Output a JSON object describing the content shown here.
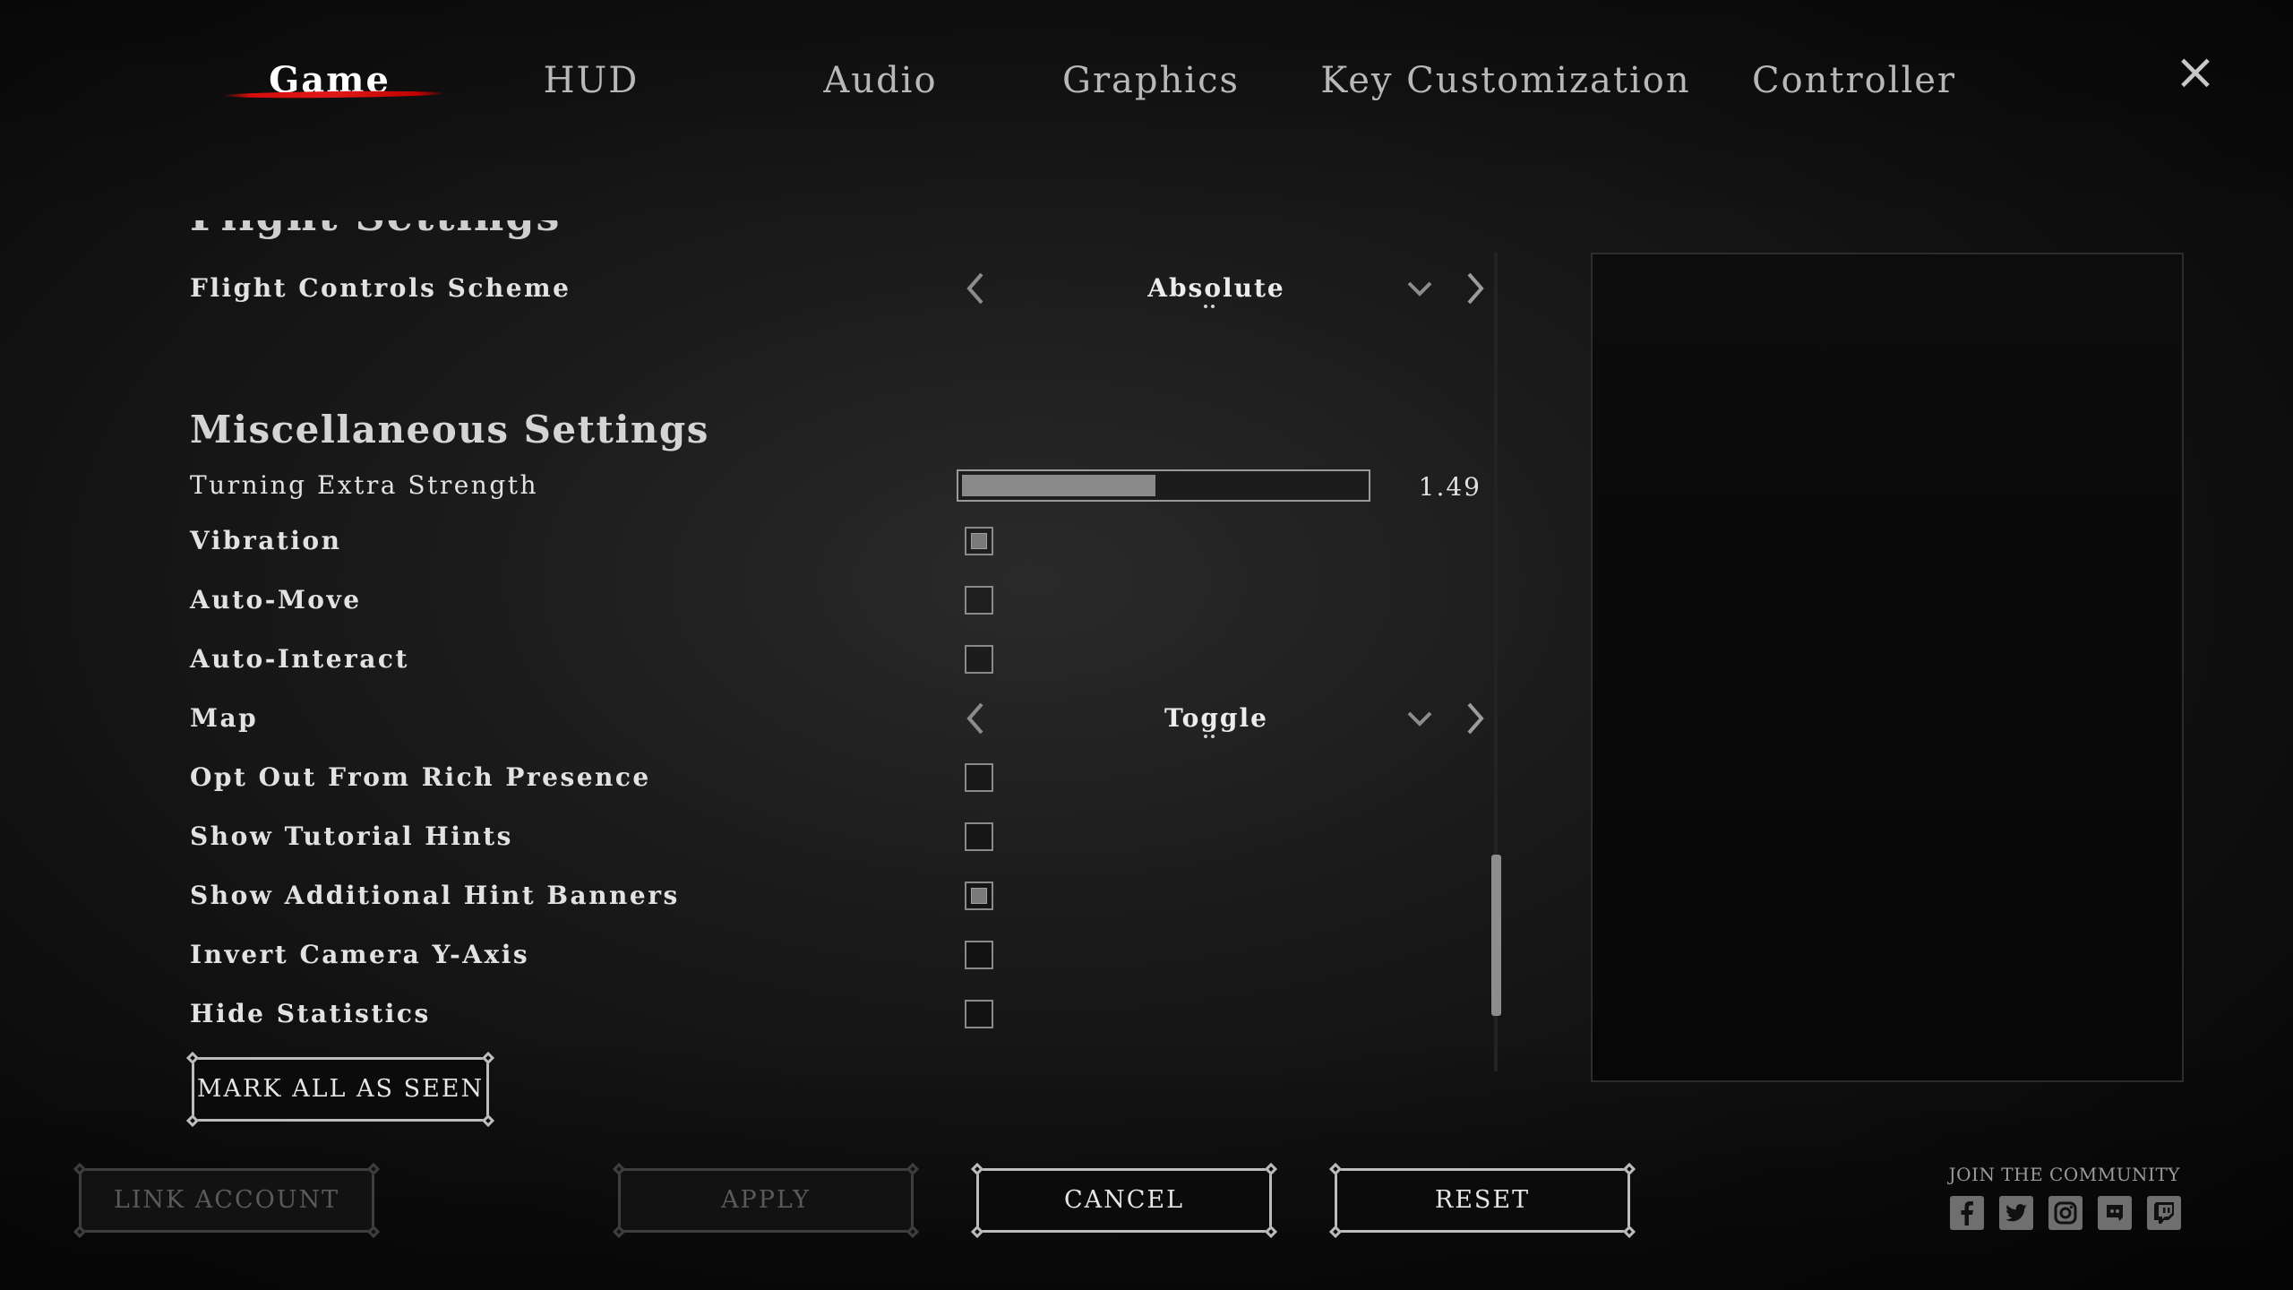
{
  "tabs": [
    {
      "label": "Game",
      "active": true
    },
    {
      "label": "HUD",
      "active": false
    },
    {
      "label": "Audio",
      "active": false
    },
    {
      "label": "Graphics",
      "active": false
    },
    {
      "label": "Key Customization",
      "active": false
    },
    {
      "label": "Controller",
      "active": false
    }
  ],
  "close_icon": "×",
  "flight": {
    "section_heading_partial": "Flight Settings",
    "controls_scheme": {
      "label": "Flight Controls Scheme",
      "value": "Absolute"
    }
  },
  "misc": {
    "heading": "Miscellaneous Settings",
    "turning_strength": {
      "label": "Turning Extra Strength",
      "value": "1.49",
      "fill_fraction": 0.48
    },
    "vibration": {
      "label": "Vibration",
      "checked": true
    },
    "auto_move": {
      "label": "Auto-Move",
      "checked": false
    },
    "auto_interact": {
      "label": "Auto-Interact",
      "checked": false
    },
    "map": {
      "label": "Map",
      "value": "Toggle"
    },
    "rich_presence": {
      "label": "Opt Out From Rich Presence",
      "checked": false
    },
    "tutorial_hints": {
      "label": "Show Tutorial Hints",
      "checked": false
    },
    "hint_banners": {
      "label": "Show Additional Hint Banners",
      "checked": true
    },
    "invert_camera": {
      "label": "Invert Camera Y-Axis",
      "checked": false
    },
    "hide_statistics": {
      "label": "Hide Statistics",
      "checked": false
    }
  },
  "mark_all_seen": "MARK ALL AS SEEN",
  "footer": {
    "link_account": "LINK ACCOUNT",
    "apply": "APPLY",
    "cancel": "CANCEL",
    "reset": "RESET",
    "community_label": "JOIN THE COMMUNITY",
    "social_icons": [
      "facebook-icon",
      "twitter-icon",
      "instagram-icon",
      "discord-icon",
      "twitch-icon"
    ]
  },
  "colors": {
    "active_tab_underline": "#d40c0c",
    "text": "#e2e2e2",
    "disabled_text": "#5a5a5a"
  }
}
